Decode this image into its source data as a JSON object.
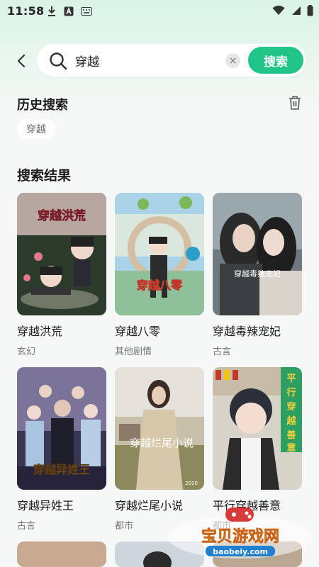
{
  "status": {
    "time": "11:58",
    "icons_left": [
      "download-icon",
      "a-icon",
      "keyboard-icon"
    ],
    "icons_right": [
      "wifi-icon",
      "signal-icon",
      "battery-icon"
    ]
  },
  "search": {
    "value": "穿越",
    "button_label": "搜索"
  },
  "history": {
    "title": "历史搜索",
    "chips": [
      "穿越"
    ]
  },
  "results": {
    "title": "搜索结果",
    "items": [
      {
        "title": "穿越洪荒",
        "genre": "玄幻",
        "cover_text": "穿越洪荒"
      },
      {
        "title": "穿越八零",
        "genre": "其他剧情",
        "cover_text": "穿越八零"
      },
      {
        "title": "穿越毒辣宠妃",
        "genre": "古言",
        "cover_text": "穿越毒辣宠妃"
      },
      {
        "title": "穿越异姓王",
        "genre": "古言",
        "cover_text": "穿越异姓王"
      },
      {
        "title": "穿越烂尾小说",
        "genre": "都市",
        "cover_text": "穿越烂尾小说"
      },
      {
        "title": "平行穿越善意",
        "genre": "都市",
        "cover_text": "平行穿越善意"
      }
    ]
  },
  "watermark": {
    "text": "宝贝游戏网",
    "url": "baobeiy.com"
  },
  "colors": {
    "accent": "#20c487",
    "background": "#f6f7f7"
  }
}
